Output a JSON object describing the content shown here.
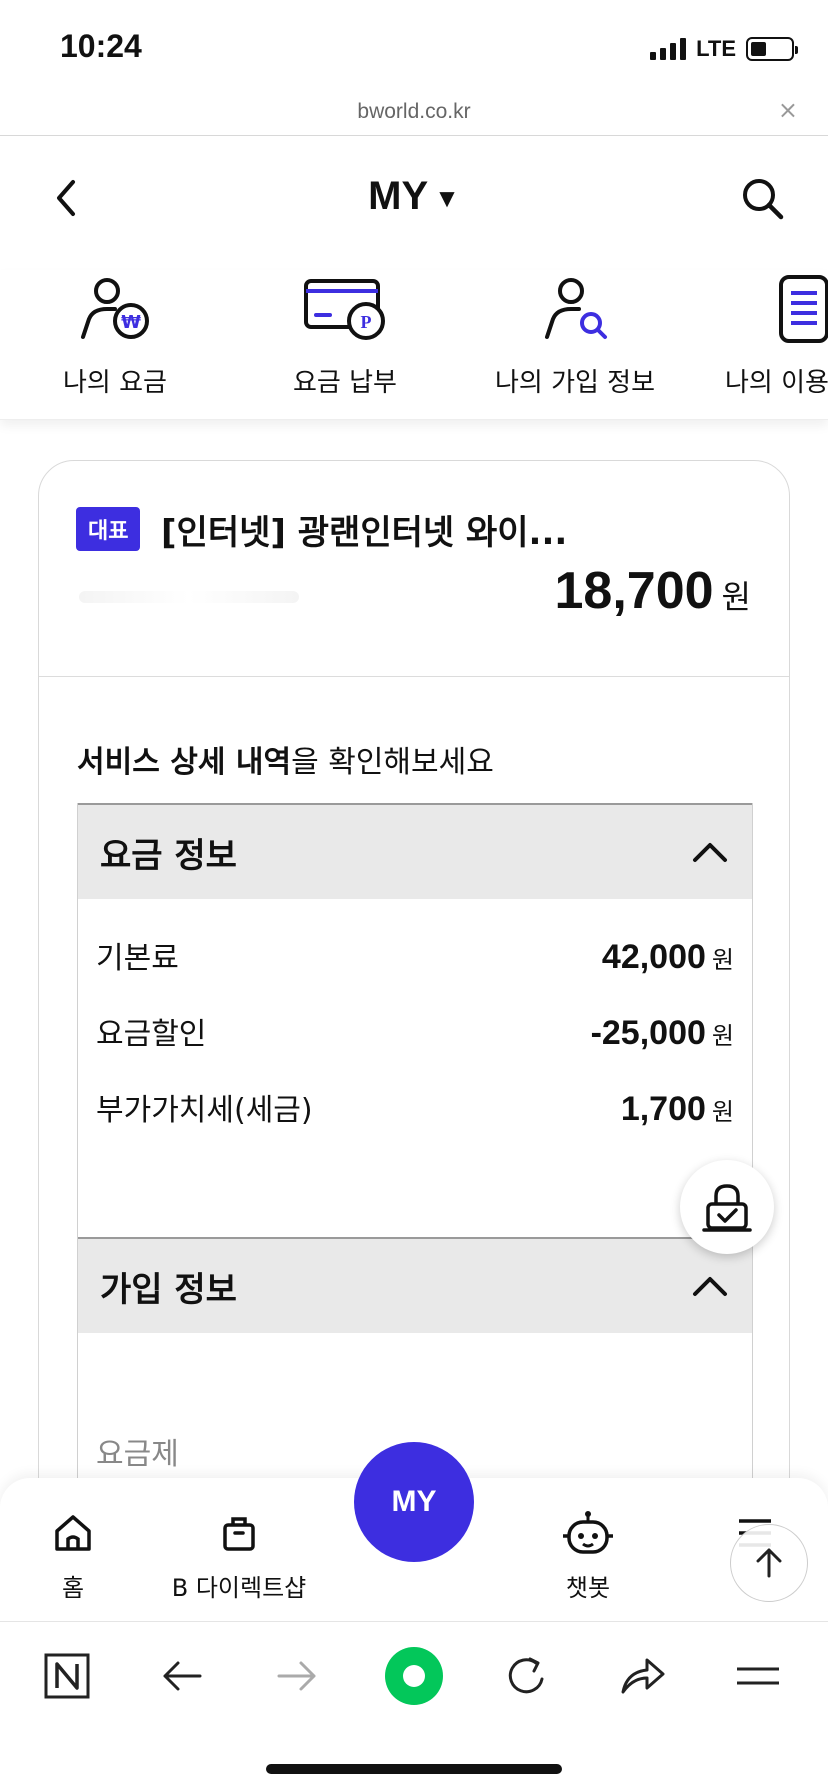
{
  "status_bar": {
    "time": "10:24",
    "network": "LTE",
    "battery_level": 0.4
  },
  "url_bar": {
    "domain": "bworld.co.kr",
    "close_glyph": "×"
  },
  "header": {
    "title": "MY",
    "caret": "▼"
  },
  "quick_menu": [
    {
      "label": "나의 요금",
      "icon": "my-bill-icon"
    },
    {
      "label": "요금 납부",
      "icon": "bill-payment-icon"
    },
    {
      "label": "나의 가입 정보",
      "icon": "subscription-info-icon"
    },
    {
      "label": "나의 이용",
      "icon": "usage-list-icon"
    }
  ],
  "summary": {
    "badge": "대표",
    "plan_name": "[인터넷] 광랜인터넷 와이...",
    "amount": "18,700",
    "amount_unit": "원"
  },
  "details": {
    "heading_bold": "서비스 상세 내역",
    "heading_rest": "을 확인해보세요"
  },
  "fee_section": {
    "title": "요금 정보",
    "rows": [
      {
        "label": "기본료",
        "value": "42,000",
        "unit": "원"
      },
      {
        "label": "요금할인",
        "value": "-25,000",
        "unit": "원"
      },
      {
        "label": "부가가치세(세금)",
        "value": "1,700",
        "unit": "원"
      }
    ]
  },
  "subscription_section": {
    "title": "가입 정보",
    "plan_label": "요금제"
  },
  "bottom_nav": {
    "items": [
      {
        "label": "홈",
        "icon": "home-icon"
      },
      {
        "label": "B 다이렉트샵",
        "icon": "shopping-bag-icon"
      },
      {
        "label": "챗봇",
        "icon": "chatbot-icon"
      },
      {
        "label": "",
        "icon": "menu-icon"
      }
    ],
    "center_label": "MY"
  },
  "colors": {
    "accent": "#3d2ee0",
    "naver_green": "#03c75a"
  }
}
